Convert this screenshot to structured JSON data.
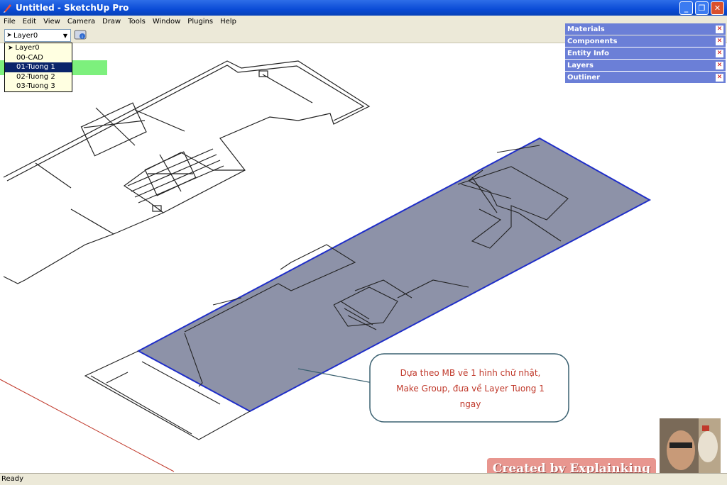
{
  "window": {
    "title": "Untitled - SketchUp Pro"
  },
  "menu": [
    "File",
    "Edit",
    "View",
    "Camera",
    "Draw",
    "Tools",
    "Window",
    "Plugins",
    "Help"
  ],
  "toolbar": {
    "layer_value": "Layer0"
  },
  "layer_dropdown": {
    "items": [
      "Layer0",
      "00-CAD",
      "01-Tuong 1",
      "02-Tuong 2",
      "03-Tuong 3"
    ],
    "selected": "01-Tuong 1"
  },
  "trays": [
    "Materials",
    "Components",
    "Entity Info",
    "Layers",
    "Outliner"
  ],
  "callout": {
    "line1": "Dựa theo MB vẽ 1 hình chữ nhật,",
    "line2": "Make Group, đưa về Layer Tuong 1",
    "line3": "ngay"
  },
  "status": {
    "text": "Ready"
  },
  "watermark": "Created by Explainking",
  "colors": {
    "titlebar": "#0a4bd6",
    "tray": "#6b7fd7",
    "selection": "#0a246a",
    "group_fill": "#8d92a8",
    "callout_text": "#c0392b"
  }
}
